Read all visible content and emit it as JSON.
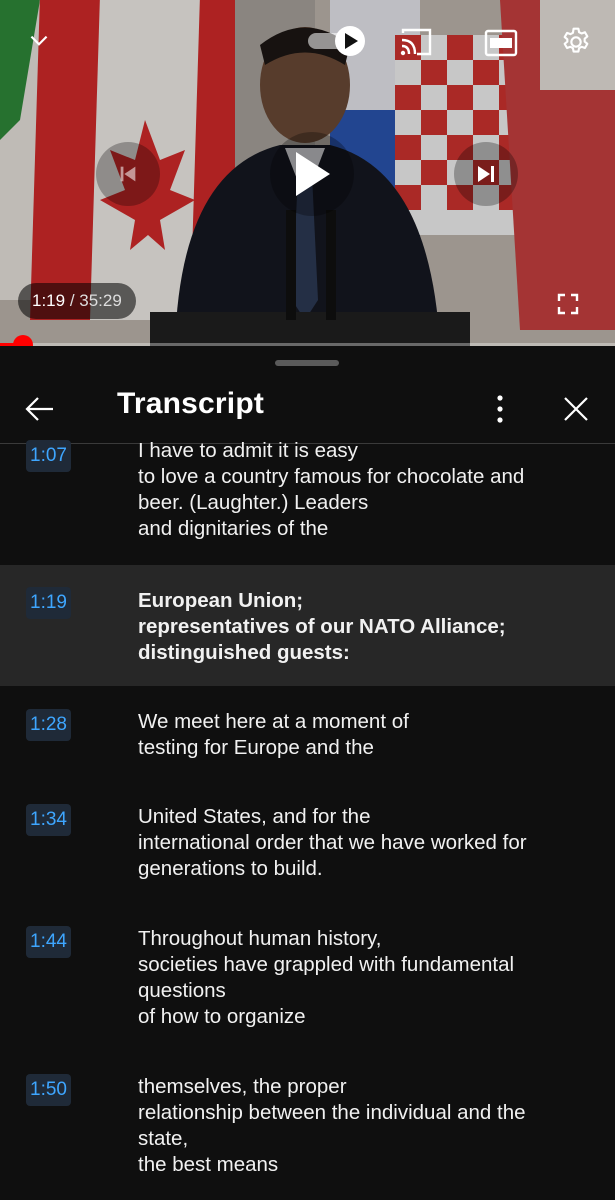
{
  "player": {
    "current_time": "1:19",
    "separator": " / ",
    "duration": "35:29",
    "progress": 0.037,
    "controls": {
      "collapse_icon": "chevron-down-icon",
      "autoplay_icon": "autoplay-toggle-icon",
      "cast_icon": "cast-icon",
      "captions_icon": "closed-captions-icon",
      "captions_label": "CC",
      "settings_icon": "gear-icon",
      "previous_icon": "skip-previous-icon",
      "play_icon": "play-icon",
      "next_icon": "skip-next-icon",
      "fullscreen_icon": "fullscreen-icon"
    }
  },
  "panel": {
    "title": "Transcript",
    "back_icon": "arrow-left-icon",
    "more_icon": "more-vertical-icon",
    "close_icon": "close-icon"
  },
  "colors": {
    "accent": "#3ea6ff",
    "progress": "#ff0000",
    "active_segment_bg": "#272727",
    "panel_bg": "#0f0f0f"
  },
  "transcript": [
    {
      "time": "1:07",
      "lines": [
        "I have to admit it is easy",
        "to love a country famous for chocolate and",
        "beer. (Laughter.) Leaders",
        "and dignitaries of the"
      ],
      "active": false
    },
    {
      "time": "1:19",
      "lines": [
        "European Union;",
        "representatives of our NATO Alliance;",
        "distinguished guests:"
      ],
      "active": true
    },
    {
      "time": "1:28",
      "lines": [
        "We meet here at a moment of",
        "testing for Europe and the"
      ],
      "active": false
    },
    {
      "time": "1:34",
      "lines": [
        "United States, and for the",
        "international order that we have worked for",
        "generations to build."
      ],
      "active": false
    },
    {
      "time": "1:44",
      "lines": [
        "Throughout human history,",
        "societies have grappled with fundamental",
        "questions",
        "of how to organize"
      ],
      "active": false
    },
    {
      "time": "1:50",
      "lines": [
        "themselves, the proper",
        "relationship between the individual and the",
        "state,",
        "the best means"
      ],
      "active": false
    }
  ]
}
